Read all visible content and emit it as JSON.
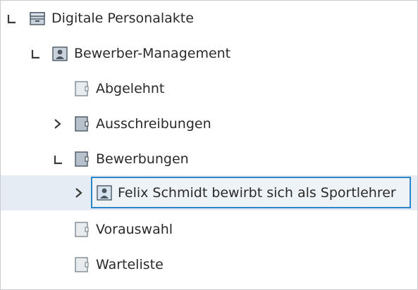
{
  "tree": {
    "nodes": [
      {
        "label": "Digitale Personalakte",
        "toggle": "expanded",
        "icon": "archive-icon"
      },
      {
        "label": "Bewerber-Management",
        "toggle": "expanded",
        "icon": "person-folder-icon"
      },
      {
        "label": "Abgelehnt",
        "toggle": "none",
        "icon": "empty-folder-icon"
      },
      {
        "label": "Ausschreibungen",
        "toggle": "collapsed",
        "icon": "folder-icon"
      },
      {
        "label": "Bewerbungen",
        "toggle": "expanded",
        "icon": "folder-icon"
      },
      {
        "label": "Felix Schmidt bewirbt sich als Sportlehrer",
        "toggle": "collapsed",
        "icon": "person-file-icon",
        "selected": true
      },
      {
        "label": "Vorauswahl",
        "toggle": "none",
        "icon": "empty-folder-icon"
      },
      {
        "label": "Warteliste",
        "toggle": "none",
        "icon": "empty-folder-icon"
      }
    ]
  },
  "colors": {
    "selection_border": "#2a86c6",
    "selection_background": "#e5ecf3",
    "text": "#2a2a2a"
  }
}
